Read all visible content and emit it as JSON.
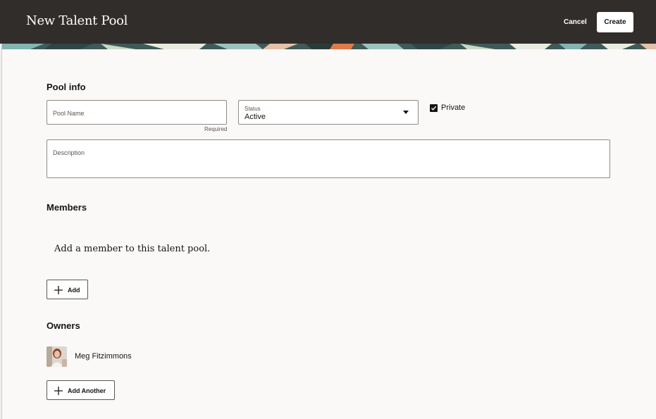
{
  "header": {
    "title": "New Talent Pool",
    "cancel_label": "Cancel",
    "create_label": "Create",
    "background": "#312d2a"
  },
  "pool_info": {
    "section_title": "Pool info",
    "pool_name": {
      "label": "Pool Name",
      "value": "",
      "helper": "Required"
    },
    "status": {
      "label": "Status",
      "value": "Active"
    },
    "private": {
      "label": "Private",
      "checked": true
    },
    "description": {
      "label": "Description",
      "value": ""
    }
  },
  "members": {
    "section_title": "Members",
    "empty_text": "Add a member to this talent pool.",
    "add_label": "Add"
  },
  "owners": {
    "section_title": "Owners",
    "items": [
      {
        "name": "Meg Fitzimmons",
        "avatar": "avatar-photo"
      }
    ],
    "add_another_label": "Add Another"
  },
  "icons": {
    "plus": "plus-icon",
    "caret": "chevron-down-icon",
    "check": "check-icon"
  }
}
